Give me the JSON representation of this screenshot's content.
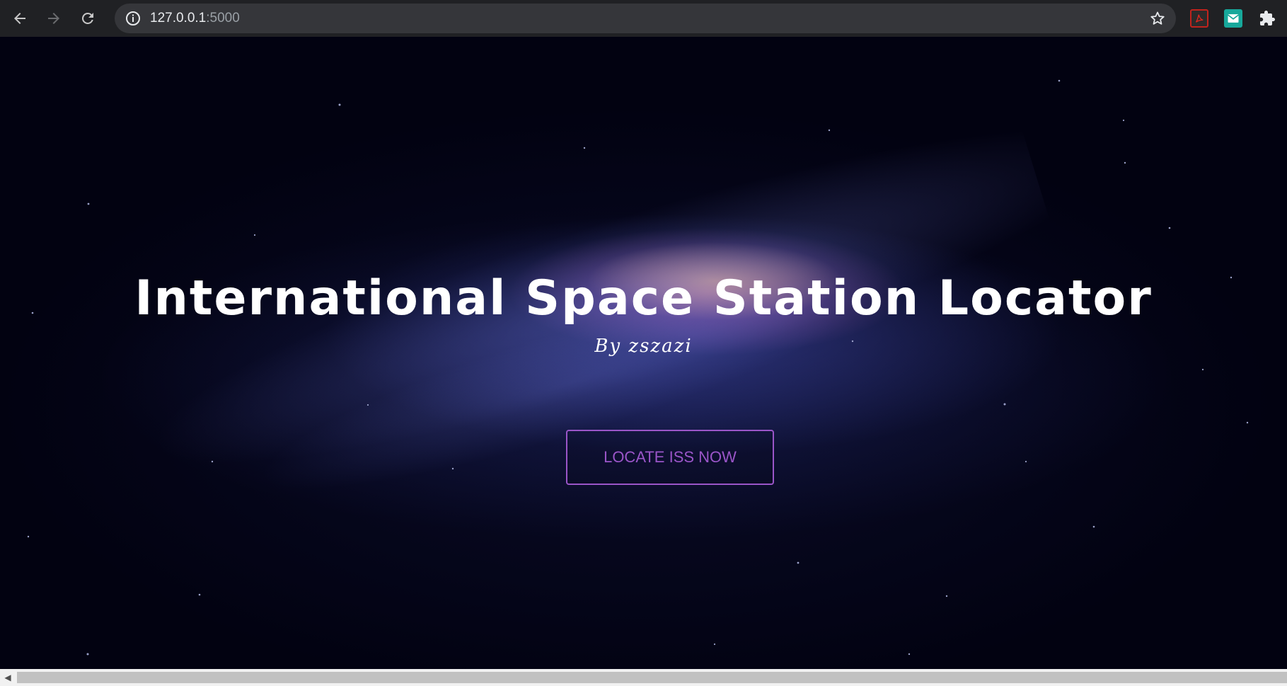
{
  "browser": {
    "url_host": "127.0.0.1",
    "url_port": ":5000",
    "icons": {
      "back": "back-arrow-icon",
      "forward": "forward-arrow-icon",
      "reload": "reload-icon",
      "info": "info-icon",
      "star": "star-icon",
      "pdf_extension": "adobe-acrobat-icon",
      "mail_extension": "mail-extension-icon",
      "extensions": "puzzle-icon"
    }
  },
  "hero": {
    "title": "International Space Station Locator",
    "subtitle": "By zszazi",
    "button_label": "LOCATE ISS NOW"
  },
  "colors": {
    "accent": "#9a55c8",
    "background": "#020211",
    "text": "#ffffff"
  }
}
